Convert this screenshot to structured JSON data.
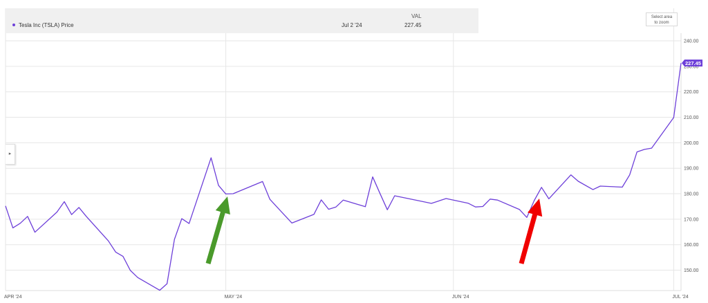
{
  "legend": {
    "column_header": "VAL",
    "series_name": "Tesla Inc (TSLA) Price",
    "date": "Jul 2 '24",
    "value": "227.45"
  },
  "controls": {
    "zoom_label_line1": "Select area",
    "zoom_label_line2": "to zoom",
    "panel_toggle_icon": "chevron-right-icon"
  },
  "colors": {
    "series": "#6d3fd9",
    "grid": "#e6e6e6",
    "green_arrow": "#4a9a2b",
    "red_arrow": "#f00000"
  },
  "chart_data": {
    "type": "line",
    "x_tick_labels": [
      "APR '24",
      "MAY '24",
      "JUN '24",
      "JUL '24"
    ],
    "x_tick_dates": [
      "2024-04-01",
      "2024-05-01",
      "2024-06-01",
      "2024-07-01"
    ],
    "xlim": [
      "2024-04-01",
      "2024-07-02"
    ],
    "y_ticks": [
      150,
      160,
      170,
      180,
      190,
      200,
      210,
      220,
      230,
      240
    ],
    "y_tick_labels": [
      "150.00",
      "160.00",
      "170.00",
      "180.00",
      "190.00",
      "200.00",
      "210.00",
      "220.00",
      "230.00",
      "240.00"
    ],
    "ylim": [
      142,
      243
    ],
    "last_value_label": "227.45",
    "grid": true,
    "series": [
      {
        "name": "Tesla Inc (TSLA) Price",
        "x": [
          "2024-04-01",
          "2024-04-02",
          "2024-04-03",
          "2024-04-04",
          "2024-04-05",
          "2024-04-08",
          "2024-04-09",
          "2024-04-10",
          "2024-04-11",
          "2024-04-12",
          "2024-04-15",
          "2024-04-16",
          "2024-04-17",
          "2024-04-18",
          "2024-04-19",
          "2024-04-22",
          "2024-04-23",
          "2024-04-24",
          "2024-04-25",
          "2024-04-26",
          "2024-04-29",
          "2024-04-30",
          "2024-05-01",
          "2024-05-02",
          "2024-05-06",
          "2024-05-07",
          "2024-05-08",
          "2024-05-10",
          "2024-05-13",
          "2024-05-14",
          "2024-05-15",
          "2024-05-16",
          "2024-05-17",
          "2024-05-20",
          "2024-05-21",
          "2024-05-22",
          "2024-05-23",
          "2024-05-24",
          "2024-05-28",
          "2024-05-29",
          "2024-05-31",
          "2024-06-03",
          "2024-06-04",
          "2024-06-05",
          "2024-06-06",
          "2024-06-07",
          "2024-06-10",
          "2024-06-11",
          "2024-06-12",
          "2024-06-13",
          "2024-06-14",
          "2024-06-17",
          "2024-06-18",
          "2024-06-20",
          "2024-06-21",
          "2024-06-24",
          "2024-06-25",
          "2024-06-26",
          "2024-06-27",
          "2024-06-28",
          "2024-07-01",
          "2024-07-02"
        ],
        "values": [
          175.2,
          166.6,
          168.4,
          171.1,
          164.9,
          172.8,
          176.9,
          171.8,
          174.6,
          171.1,
          161.5,
          157.1,
          155.4,
          149.9,
          147.1,
          142.1,
          144.7,
          162.1,
          170.2,
          168.3,
          194.1,
          183.3,
          179.9,
          180.0,
          184.8,
          177.8,
          174.7,
          168.5,
          171.9,
          177.6,
          173.9,
          174.8,
          177.5,
          174.9,
          186.6,
          180.1,
          173.7,
          179.2,
          176.8,
          176.2,
          178.1,
          176.3,
          174.8,
          175.0,
          177.9,
          177.5,
          173.8,
          170.7,
          177.3,
          182.5,
          178.0,
          187.4,
          184.9,
          181.6,
          183.0,
          182.6,
          187.4,
          196.4,
          197.4,
          197.9,
          209.9,
          231.3
        ]
      }
    ]
  }
}
